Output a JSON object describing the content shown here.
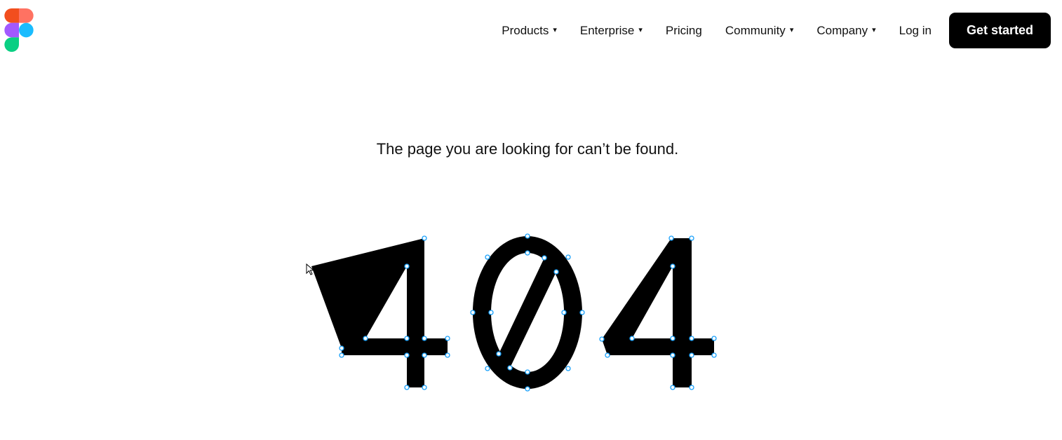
{
  "header": {
    "logo_name": "figma-logo",
    "nav": [
      {
        "label": "Products",
        "has_dropdown": true
      },
      {
        "label": "Enterprise",
        "has_dropdown": true
      },
      {
        "label": "Pricing",
        "has_dropdown": false
      },
      {
        "label": "Community",
        "has_dropdown": true
      },
      {
        "label": "Company",
        "has_dropdown": true
      },
      {
        "label": "Log in",
        "has_dropdown": false
      }
    ],
    "dropdown_glyph": "▾",
    "cta_label": "Get started"
  },
  "main": {
    "message": "The page you are looking for can’t be found.",
    "error_code": "404"
  },
  "colors": {
    "accent_black": "#000000",
    "vector_handle": "#18a0fb",
    "logo_red": "#f24e1e",
    "logo_orange": "#ff7262",
    "logo_purple": "#a259ff",
    "logo_blue": "#1abcfe",
    "logo_green": "#0acf83"
  }
}
